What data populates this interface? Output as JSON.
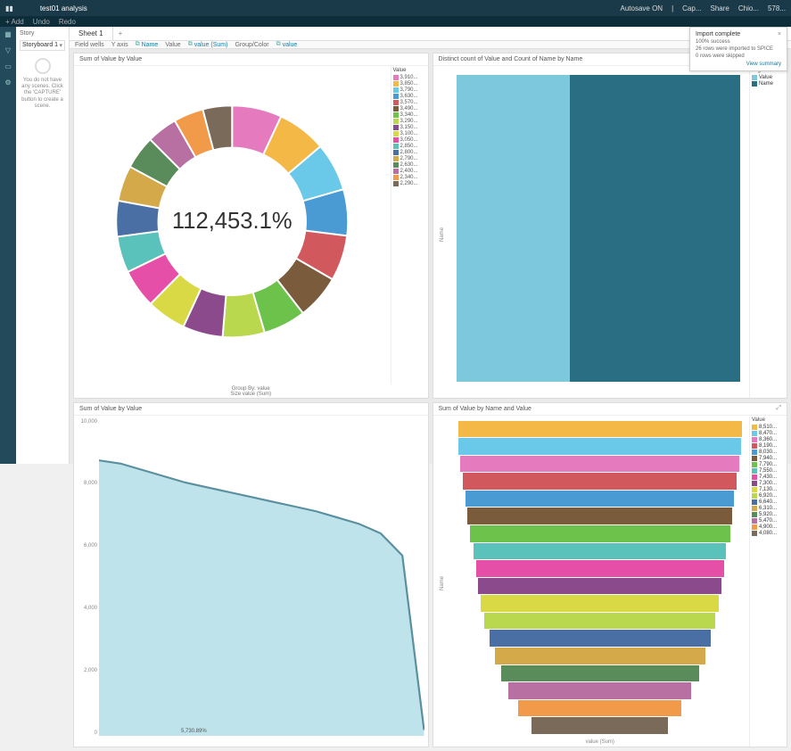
{
  "topbar": {
    "logo": "📊",
    "title": "test01 analysis",
    "autosave": "Autosave ON",
    "right_items": [
      "Cap...",
      "Share",
      "Chio...",
      "578..."
    ]
  },
  "menubar": {
    "add": "+ Add",
    "undo": "Undo",
    "redo": "Redo"
  },
  "leftrail": {
    "items": [
      "Visualize",
      "Filter",
      "Story",
      "Parameters"
    ]
  },
  "sidebar": {
    "title": "Story",
    "storyboard_label": "Storyboard 1",
    "capture_msg": "You do not have any scenes. Click the 'CAPTURE' button to create a scene."
  },
  "tabs": {
    "active": "Sheet 1"
  },
  "fieldwells": {
    "label": "Field wells",
    "y_axis": "Y axis",
    "y_val": "Name",
    "value": "Value",
    "value_val": "value (Sum)",
    "group": "Group/Color",
    "group_val": "value"
  },
  "panels": {
    "donut": {
      "title": "Sum of Value by Value",
      "center": "112,453.1%",
      "footer1": "Group By: value",
      "footer2": "Size value (Sum)",
      "legend_title": "Value"
    },
    "stack": {
      "title": "Distinct count of Value and Count of Name by Name",
      "ylabel": "Name",
      "legend_title": "Legend",
      "legend_items": [
        "Value",
        "Name"
      ]
    },
    "area": {
      "title": "Sum of Value by Value",
      "ymax": "10,000",
      "y2": "8,000",
      "y3": "6,000",
      "y4": "4,000",
      "y5": "2,000",
      "ymin": "0",
      "pt_label": "5,730.89%"
    },
    "funnel": {
      "title": "Sum of Value by Name and Value",
      "ylabel": "Name",
      "xlabel": "value (Sum)",
      "legend_title": "Value"
    }
  },
  "notif": {
    "title": "Import complete",
    "line1": "100% success",
    "line2": "26 rows were imported to SPICE",
    "line3": "0 rows were skipped",
    "link": "View summary"
  },
  "chart_data": [
    {
      "type": "pie",
      "title": "Sum of Value by Value",
      "center_value": "112,453.1%",
      "slices": [
        {
          "name": "3,910",
          "value": 3910,
          "color": "#e67abf"
        },
        {
          "name": "3,850",
          "value": 3850,
          "color": "#f4b847"
        },
        {
          "name": "3,790",
          "value": 3790,
          "color": "#6ac8e8"
        },
        {
          "name": "3,630",
          "value": 3630,
          "color": "#4a9bd4"
        },
        {
          "name": "3,570",
          "value": 3570,
          "color": "#d1585d"
        },
        {
          "name": "3,490",
          "value": 3490,
          "color": "#7a5c3c"
        },
        {
          "name": "3,340",
          "value": 3340,
          "color": "#6cc24a"
        },
        {
          "name": "3,290",
          "value": 3290,
          "color": "#b9d84e"
        },
        {
          "name": "3,150",
          "value": 3150,
          "color": "#8b4a8b"
        },
        {
          "name": "3,100",
          "value": 3100,
          "color": "#d9d845"
        },
        {
          "name": "3,050",
          "value": 3050,
          "color": "#e64fa8"
        },
        {
          "name": "2,850",
          "value": 2850,
          "color": "#5ac1bb"
        },
        {
          "name": "2,800",
          "value": 2800,
          "color": "#4a6fa5"
        },
        {
          "name": "2,790",
          "value": 2790,
          "color": "#d4a94a"
        },
        {
          "name": "2,630",
          "value": 2630,
          "color": "#5a8b5a"
        },
        {
          "name": "2,400",
          "value": 2400,
          "color": "#b86fa2"
        },
        {
          "name": "2,340",
          "value": 2340,
          "color": "#f09a4a"
        },
        {
          "name": "2,290",
          "value": 2290,
          "color": "#7a6a5a"
        }
      ]
    },
    {
      "type": "bar",
      "title": "Distinct count of Value and Count of Name by Name",
      "orientation": "horizontal-stacked",
      "categories": [
        "Name"
      ],
      "series": [
        {
          "name": "Value",
          "color": "#7ec8de",
          "values": [
            40
          ]
        },
        {
          "name": "Name",
          "color": "#2a6e84",
          "values": [
            60
          ]
        }
      ]
    },
    {
      "type": "area",
      "title": "Sum of Value by Value",
      "ylim": [
        0,
        10000
      ],
      "yticks": [
        0,
        2000,
        4000,
        6000,
        8000,
        10000
      ],
      "x": [
        0,
        1,
        2,
        3,
        4,
        5,
        6,
        7,
        8,
        9,
        10,
        11,
        12,
        13,
        14,
        15
      ],
      "values": [
        8700,
        8600,
        8400,
        8200,
        8000,
        7850,
        7700,
        7550,
        7400,
        7250,
        7100,
        6900,
        6700,
        6400,
        5700,
        200
      ],
      "point_label": "5,730.89%"
    },
    {
      "type": "bar",
      "title": "Sum of Value by Name and Value",
      "orientation": "horizontal-funnel",
      "ylabel": "Name",
      "xlabel": "value (Sum)",
      "series": [
        {
          "name": "8,510",
          "value": 8510,
          "color": "#f4b847"
        },
        {
          "name": "8,470",
          "value": 8470,
          "color": "#6ac8e8"
        },
        {
          "name": "8,360",
          "value": 8360,
          "color": "#e67abf"
        },
        {
          "name": "8,190",
          "value": 8190,
          "color": "#d1585d"
        },
        {
          "name": "8,030",
          "value": 8030,
          "color": "#4a9bd4"
        },
        {
          "name": "7,940",
          "value": 7940,
          "color": "#7a5c3c"
        },
        {
          "name": "7,790",
          "value": 7790,
          "color": "#6cc24a"
        },
        {
          "name": "7,550",
          "value": 7550,
          "color": "#5ac1bb"
        },
        {
          "name": "7,430",
          "value": 7430,
          "color": "#e64fa8"
        },
        {
          "name": "7,300",
          "value": 7300,
          "color": "#8b4a8b"
        },
        {
          "name": "7,130",
          "value": 7130,
          "color": "#d9d845"
        },
        {
          "name": "6,920",
          "value": 6920,
          "color": "#b9d84e"
        },
        {
          "name": "6,640",
          "value": 6640,
          "color": "#4a6fa5"
        },
        {
          "name": "6,310",
          "value": 6310,
          "color": "#d4a94a"
        },
        {
          "name": "5,920",
          "value": 5920,
          "color": "#5a8b5a"
        },
        {
          "name": "5,470",
          "value": 5470,
          "color": "#b86fa2"
        },
        {
          "name": "4,900",
          "value": 4900,
          "color": "#f09a4a"
        },
        {
          "name": "4,080",
          "value": 4080,
          "color": "#7a6a5a"
        }
      ]
    }
  ]
}
